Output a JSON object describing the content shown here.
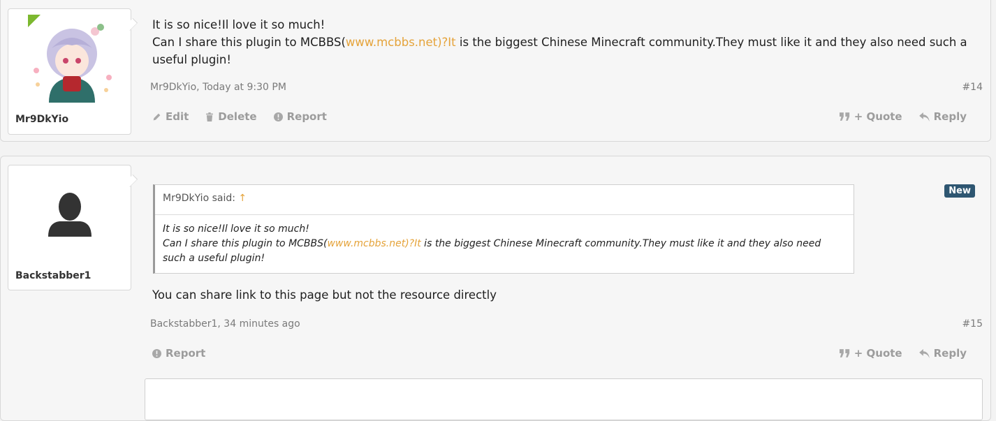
{
  "posts": [
    {
      "username": "Mr9DkYio",
      "message_line1": "It is so nice!Il love it so much!",
      "message_line2_pre": "Can I share this plugin to MCBBS(",
      "message_link": "www.mcbbs.net)?It",
      "message_line2_post": " is the biggest Chinese Minecraft community.They must like it and they also need such a useful plugin!",
      "meta": "Mr9DkYio, Today at 9:30 PM",
      "number": "#14",
      "actions_left": {
        "edit": "Edit",
        "delete": "Delete",
        "report": "Report"
      },
      "actions_right": {
        "quote": "+ Quote",
        "reply": "Reply"
      }
    },
    {
      "username": "Backstabber1",
      "badge": "New",
      "quote": {
        "author": "Mr9DkYio said:",
        "up_arrow": "↑",
        "line1": "It is so nice!Il love it so much!",
        "line2_pre": "Can I share this plugin to MCBBS(",
        "link": "www.mcbbs.net)?It",
        "line2_post": " is the biggest Chinese Minecraft community.They must like it and they also need such a useful plugin!"
      },
      "message": "You can share link to this page but not the resource directly",
      "meta": "Backstabber1, 34 minutes ago",
      "number": "#15",
      "actions_left": {
        "report": "Report"
      },
      "actions_right": {
        "quote": "+ Quote",
        "reply": "Reply"
      }
    }
  ],
  "colors": {
    "link": "#e5a33a",
    "badge": "#2e5671",
    "online_indicator": "#7cb82f"
  },
  "icons": [
    "pencil-icon",
    "trash-icon",
    "report-icon",
    "quote-icon",
    "reply-icon",
    "user-silhouette-icon"
  ]
}
